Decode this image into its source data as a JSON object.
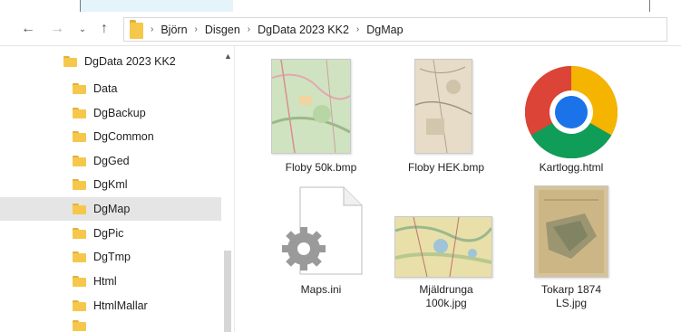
{
  "window": {
    "title": "DgMap"
  },
  "address": {
    "crumbs": [
      "Björn",
      "Disgen",
      "DgData 2023 KK2",
      "DgMap"
    ]
  },
  "sidebar": {
    "items": [
      {
        "label": "DgData 2023 KK2",
        "selected": false
      },
      {
        "label": "Data",
        "selected": false
      },
      {
        "label": "DgBackup",
        "selected": false
      },
      {
        "label": "DgCommon",
        "selected": false
      },
      {
        "label": "DgGed",
        "selected": false
      },
      {
        "label": "DgKml",
        "selected": false
      },
      {
        "label": "DgMap",
        "selected": true
      },
      {
        "label": "DgPic",
        "selected": false
      },
      {
        "label": "DgTmp",
        "selected": false
      },
      {
        "label": "Html",
        "selected": false
      },
      {
        "label": "HtmlMallar",
        "selected": false
      }
    ]
  },
  "files": [
    {
      "name": "Floby 50k.bmp",
      "icon": "map-thumbnail"
    },
    {
      "name": "Floby HEK.bmp",
      "icon": "map-thumbnail"
    },
    {
      "name": "Kartlogg.html",
      "icon": "chrome-icon"
    },
    {
      "name": "Maps.ini",
      "icon": "settings-file-icon"
    },
    {
      "name": "Mjäldrunga 100k.jpg",
      "name_lines": [
        "Mjäldrunga",
        "100k.jpg"
      ],
      "icon": "map-thumbnail"
    },
    {
      "name": "Tokarp 1874 LS.jpg",
      "name_lines": [
        "Tokarp 1874",
        "LS.jpg"
      ],
      "icon": "map-thumbnail"
    }
  ],
  "colors": {
    "selection": "#e5e5e5",
    "folder": "#f5c84c",
    "accent": "#0078d4"
  }
}
